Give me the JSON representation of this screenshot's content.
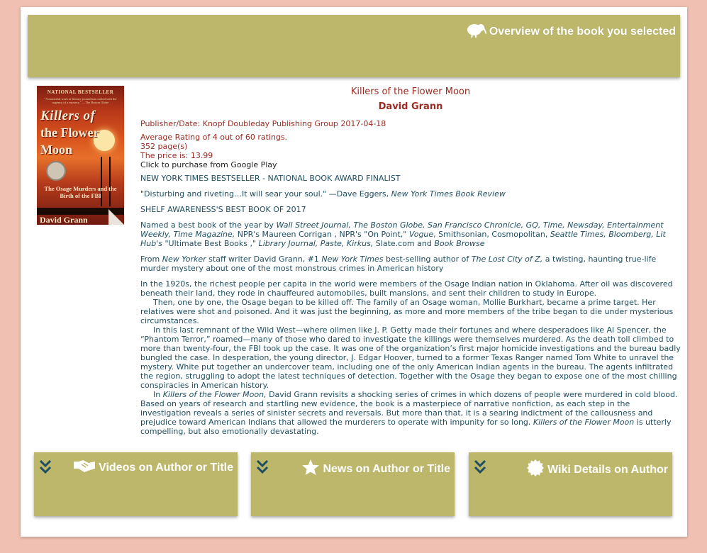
{
  "header": {
    "title": "Overview of the book you selected",
    "icon": "kiwi-bird-icon"
  },
  "cover": {
    "badge": "NATIONAL BESTSELLER",
    "blurb": "\"A masterful work of literary journalism crafted with the urgency of a mystery.\" —The Boston Globe",
    "title_line1": "Killers of",
    "title_line2": "the Flower",
    "title_line3": "Moon",
    "subtitle": "The Osage Murders and the Birth of the FBI",
    "author": "David Grann"
  },
  "book": {
    "title": "Killers of the Flower Moon",
    "author": "David Grann",
    "publisher_line": "Publisher/Date:  Knopf Doubleday Publishing Group 2017-04-18",
    "rating_line": "Average Rating of 4 out of 60 ratings.",
    "pages_line": "352 page(s)",
    "price_line": "The price is: 13.99",
    "purchase_link": "Click to purchase from Google Play"
  },
  "description": {
    "p1": "NEW YORK TIMES BESTSELLER  -  NATIONAL BOOK AWARD FINALIST",
    "p2_quote": "\"Disturbing and riveting…It will sear your soul.\" —Dave Eggers, ",
    "p2_source": "New York Times Book Review",
    "p3": "SHELF AWARENESS'S BEST BOOK OF 2017",
    "p4_a": "Named a best book of the year by ",
    "p4_b": "Wall Street Journal, The Boston Globe, San Francisco Chronicle, GQ, Time, Newsday, Entertainment Weekly, Time Magazine,",
    "p4_c": " NPR's Maureen Corrigan , NPR's \"On Point,\" ",
    "p4_d": "Vogue",
    "p4_e": ", Smithsonian, Cosmopolitan, ",
    "p4_f": "Seattle Times, Bloomberg, Lit Hub's",
    "p4_g": " \"Ultimate Best Books ,\" ",
    "p4_h": "Library Journal, Paste, Kirkus,",
    "p4_i": " Slate.com  and ",
    "p4_j": "Book Browse",
    "p5_a": "From ",
    "p5_b": "New Yorker",
    "p5_c": " staff writer David Grann, #1 ",
    "p5_d": "New York Times",
    "p5_e": " best-selling author of ",
    "p5_f": "The Lost City of Z,",
    "p5_g": " a twisting, haunting true-life murder mystery about one of the most monstrous crimes in American history",
    "s1": "In the 1920s, the richest people per capita in the world were members of the Osage Indian nation in Oklahoma. After oil was discovered beneath their land, they rode in chauffeured automobiles, built mansions, and sent their children to study in Europe.",
    "s2": "Then, one by one, the Osage began to be killed off. The family of an Osage woman, Mollie Burkhart, became a prime target. Her relatives were shot and poisoned. And it was just the beginning, as more and more members of the tribe began to die under mysterious circumstances.",
    "s3": "In this last remnant of the Wild West—where oilmen like J. P. Getty made their fortunes and where desperadoes like Al Spencer, the “Phantom Terror,” roamed—many of those who dared to investigate the killings were themselves murdered. As the death toll climbed to more than twenty-four, the FBI took up the case. It was one of the organization’s first major homicide investigations and the bureau badly bungled the case. In desperation, the young director, J. Edgar Hoover, turned to a former Texas Ranger named Tom White to unravel the mystery. White put together an undercover team, including one of the only American Indian agents in the bureau. The agents infiltrated the region, struggling to adopt the latest techniques of detection.  Together with the Osage they began to expose one of the most chilling conspiracies in American history.",
    "s4_a": "In ",
    "s4_b": "Killers of the Flower Moon,",
    "s4_c": " David Grann revisits a shocking series of crimes in which dozens of people were murdered in cold blood. Based on years of research and startling new evidence, the book is a masterpiece of narrative nonfiction, as each step in the investigation reveals a series of sinister secrets and reversals. But more than that, it is a searing indictment of the callousness and prejudice toward American Indians that allowed the murderers to operate with impunity for so long. ",
    "s4_d": "Killers of the Flower Moon",
    "s4_e": " is utterly compelling, but also emotionally devastating."
  },
  "buttons": [
    {
      "label": "Videos on Author or Title",
      "icon": "handshake-icon"
    },
    {
      "label": "News on Author or Title",
      "icon": "star-icon"
    },
    {
      "label": "Wiki Details on Author",
      "icon": "certificate-icon"
    }
  ],
  "colors": {
    "background": "#f0c0b2",
    "panel": "#bdb76b",
    "accent_red": "#9b2a22",
    "text_teal": "#1e4e60"
  }
}
